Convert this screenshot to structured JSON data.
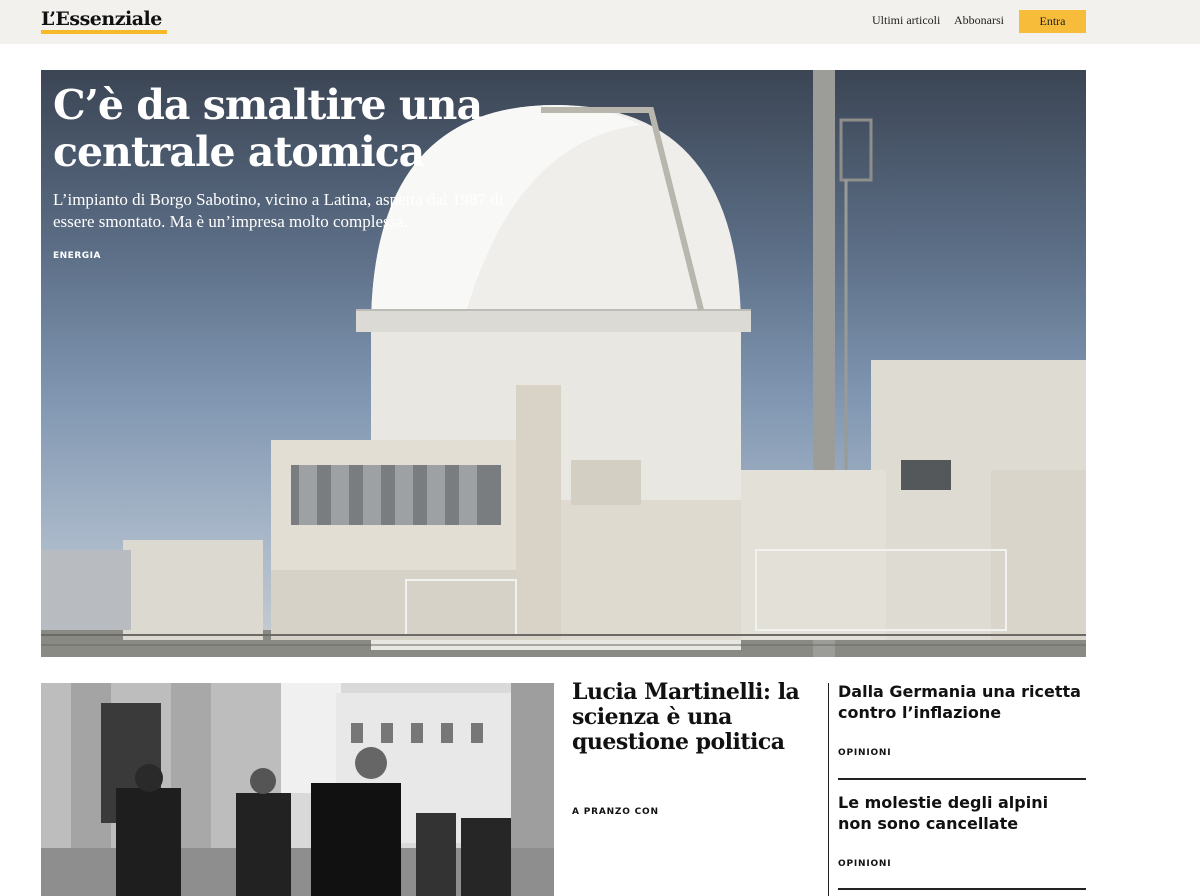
{
  "header": {
    "logo": "L’Essenziale",
    "nav": {
      "latest_label": "Ultimi articoli",
      "subscribe_label": "Abbonarsi",
      "login_label": "Entra"
    },
    "accent_color": "#f7bc3a"
  },
  "hero": {
    "title": "C’è da smaltire una centrale atomica",
    "description": "L’impianto di Borgo Sabotino, vicino a Latina, aspetta dal 1987 di essere smontato. Ma è un’impresa molto complessa.",
    "tag": "ENERGIA",
    "image": "nuclear-power-plant-photo"
  },
  "feature": {
    "image": "politicians-walking-bw-photo",
    "title": "Lucia Martinelli: la scienza è una questione politica",
    "tag": "A PRANZO CON"
  },
  "side_list": [
    {
      "title": "Dalla Germania una ricetta contro l’inflazione",
      "tag": "OPINIONI"
    },
    {
      "title": "Le molestie degli alpini non sono cancellate",
      "tag": "OPINIONI"
    }
  ]
}
